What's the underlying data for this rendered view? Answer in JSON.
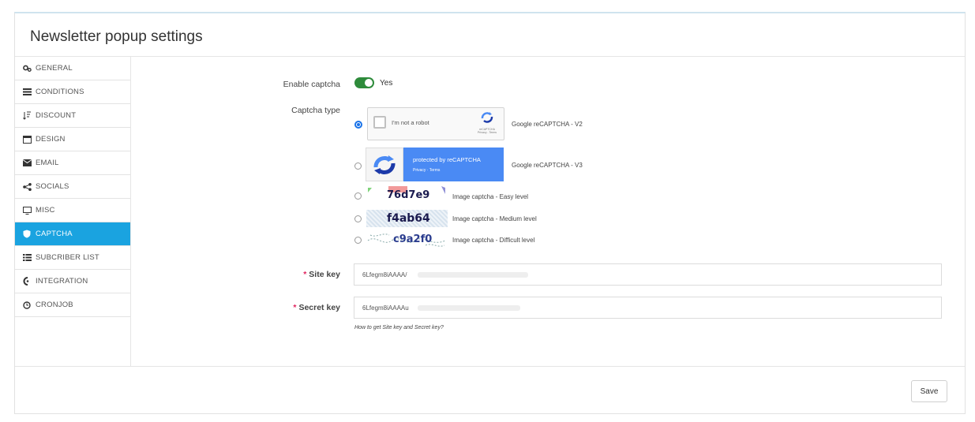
{
  "header": {
    "title": "Newsletter popup settings"
  },
  "sidebar": {
    "items": [
      {
        "label": "GENERAL",
        "icon": "gears-icon"
      },
      {
        "label": "CONDITIONS",
        "icon": "list-icon"
      },
      {
        "label": "DISCOUNT",
        "icon": "sort-icon"
      },
      {
        "label": "DESIGN",
        "icon": "window-icon"
      },
      {
        "label": "EMAIL",
        "icon": "envelope-icon"
      },
      {
        "label": "SOCIALS",
        "icon": "share-icon"
      },
      {
        "label": "MISC",
        "icon": "monitor-icon"
      },
      {
        "label": "CAPTCHA",
        "icon": "shield-icon"
      },
      {
        "label": "SUBCRIBER LIST",
        "icon": "table-list-icon"
      },
      {
        "label": "INTEGRATION",
        "icon": "integration-icon"
      },
      {
        "label": "CRONJOB",
        "icon": "clock-icon"
      }
    ],
    "active_index": 7
  },
  "form": {
    "enable_captcha": {
      "label": "Enable captcha",
      "value": "Yes"
    },
    "captcha_type": {
      "label": "Captcha type",
      "options": [
        {
          "label": "Google reCAPTCHA - V2",
          "selected": true
        },
        {
          "label": "Google reCAPTCHA - V3",
          "selected": false
        },
        {
          "label": "Image captcha - Easy level",
          "sample": "76d7e9",
          "selected": false
        },
        {
          "label": "Image captcha - Medium level",
          "sample": "f4ab64",
          "selected": false
        },
        {
          "label": "Image captcha - Difficult level",
          "sample": "c9a2f0",
          "selected": false
        }
      ],
      "recaptcha_v2": {
        "checkbox_text": "I'm not a robot",
        "brand": "reCAPTCHA",
        "links": "Privacy - Terms"
      },
      "recaptcha_v3": {
        "line1": "protected by reCAPTCHA",
        "line2": "Privacy · Terms"
      }
    },
    "site_key": {
      "required_mark": "*",
      "label": "Site key",
      "value": "6Lfegm8iAAAA/"
    },
    "secret_key": {
      "required_mark": "*",
      "label": "Secret key",
      "value": "6Lfegm8iAAAAu"
    },
    "help_text": "How to get Site key and Secret key?"
  },
  "footer": {
    "save_label": "Save"
  },
  "colors": {
    "accent": "#1aa3e0",
    "toggle_on": "#2e8b3b",
    "recaptcha_blue": "#4a8af4",
    "required": "#e0245e"
  }
}
